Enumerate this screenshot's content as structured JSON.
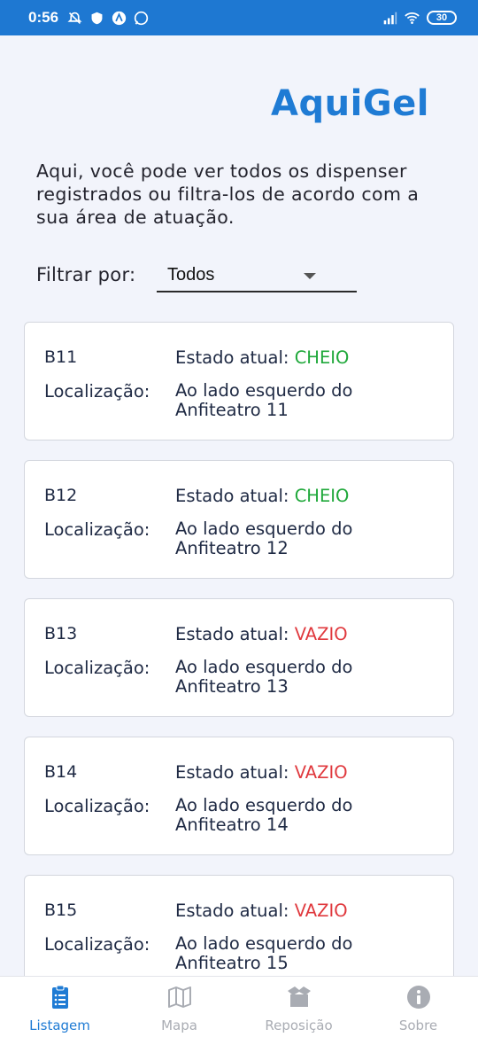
{
  "status_bar": {
    "time": "0:56",
    "battery": "30",
    "left_icons": [
      "muted-bell-icon",
      "shield-icon",
      "app-a-icon",
      "whatsapp-icon"
    ],
    "right_icons": [
      "signal-icon",
      "wifi-icon",
      "battery-icon"
    ]
  },
  "header": {
    "title": "AquiGel"
  },
  "intro": {
    "text": "Aqui, você pode ver todos os dispenser registrados ou filtra-los de acordo com a sua área de atuação."
  },
  "filter": {
    "label": "Filtrar por:",
    "selected": "Todos"
  },
  "colors": {
    "accent": "#1f7bd4",
    "status_bar": "#1e78d2",
    "cheio": "#1fa83a",
    "vazio": "#e0393e",
    "background": "#f2f4fb"
  },
  "dispensers": [
    {
      "id": "B11",
      "state_label": "Estado atual:",
      "state": "CHEIO",
      "loc_label": "Localização:",
      "location": "Ao lado esquerdo do Anfiteatro 11"
    },
    {
      "id": "B12",
      "state_label": "Estado atual:",
      "state": "CHEIO",
      "loc_label": "Localização:",
      "location": "Ao lado esquerdo do Anfiteatro 12"
    },
    {
      "id": "B13",
      "state_label": "Estado atual:",
      "state": "VAZIO",
      "loc_label": "Localização:",
      "location": "Ao lado esquerdo do Anfiteatro 13"
    },
    {
      "id": "B14",
      "state_label": "Estado atual:",
      "state": "VAZIO",
      "loc_label": "Localização:",
      "location": "Ao lado esquerdo do Anfiteatro 14"
    },
    {
      "id": "B15",
      "state_label": "Estado atual:",
      "state": "VAZIO",
      "loc_label": "Localização:",
      "location": "Ao lado esquerdo do Anfiteatro 15"
    }
  ],
  "bottom_nav": {
    "items": [
      {
        "label": "Listagem",
        "icon": "clipboard-list-icon",
        "active": true
      },
      {
        "label": "Mapa",
        "icon": "map-icon",
        "active": false
      },
      {
        "label": "Reposição",
        "icon": "box-open-icon",
        "active": false
      },
      {
        "label": "Sobre",
        "icon": "info-circle-icon",
        "active": false
      }
    ]
  }
}
